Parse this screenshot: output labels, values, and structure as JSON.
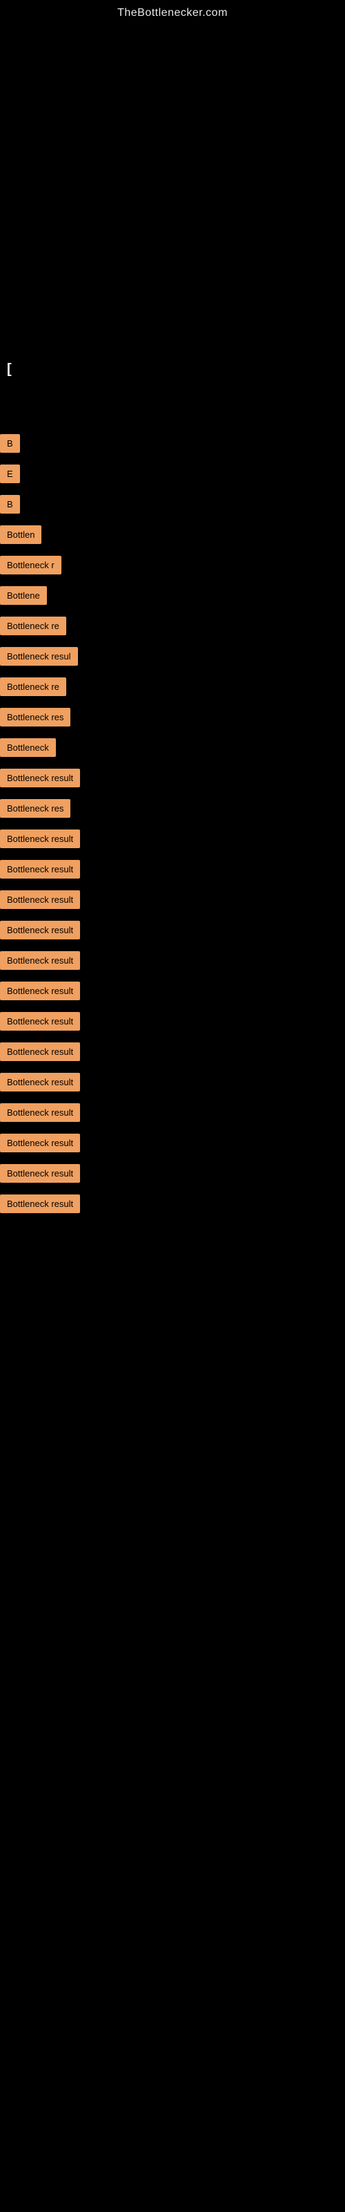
{
  "site": {
    "title": "TheBottlenecker.com"
  },
  "cursor": {
    "symbol": "["
  },
  "results": [
    {
      "id": 1,
      "label": "B",
      "width_class": "badge-w1"
    },
    {
      "id": 2,
      "label": "E",
      "width_class": "badge-w2"
    },
    {
      "id": 3,
      "label": "B",
      "width_class": "badge-w3"
    },
    {
      "id": 4,
      "label": "Bottlen",
      "width_class": "badge-w4"
    },
    {
      "id": 5,
      "label": "Bottleneck r",
      "width_class": "badge-w5"
    },
    {
      "id": 6,
      "label": "Bottlene",
      "width_class": "badge-w6"
    },
    {
      "id": 7,
      "label": "Bottleneck re",
      "width_class": "badge-w7"
    },
    {
      "id": 8,
      "label": "Bottleneck resul",
      "width_class": "badge-w8"
    },
    {
      "id": 9,
      "label": "Bottleneck re",
      "width_class": "badge-w9"
    },
    {
      "id": 10,
      "label": "Bottleneck res",
      "width_class": "badge-w10"
    },
    {
      "id": 11,
      "label": "Bottleneck",
      "width_class": "badge-w11"
    },
    {
      "id": 12,
      "label": "Bottleneck result",
      "width_class": "badge-w12"
    },
    {
      "id": 13,
      "label": "Bottleneck res",
      "width_class": "badge-w13"
    },
    {
      "id": 14,
      "label": "Bottleneck result",
      "width_class": "badge-w14"
    },
    {
      "id": 15,
      "label": "Bottleneck result",
      "width_class": "badge-w15"
    },
    {
      "id": 16,
      "label": "Bottleneck result",
      "width_class": "badge-w16"
    },
    {
      "id": 17,
      "label": "Bottleneck result",
      "width_class": "badge-w17"
    },
    {
      "id": 18,
      "label": "Bottleneck result",
      "width_class": "badge-w18"
    },
    {
      "id": 19,
      "label": "Bottleneck result",
      "width_class": "badge-w19"
    },
    {
      "id": 20,
      "label": "Bottleneck result",
      "width_class": "badge-w20"
    },
    {
      "id": 21,
      "label": "Bottleneck result",
      "width_class": "badge-w21"
    },
    {
      "id": 22,
      "label": "Bottleneck result",
      "width_class": "badge-w22"
    },
    {
      "id": 23,
      "label": "Bottleneck result",
      "width_class": "badge-w23"
    },
    {
      "id": 24,
      "label": "Bottleneck result",
      "width_class": "badge-w24"
    },
    {
      "id": 25,
      "label": "Bottleneck result",
      "width_class": "badge-w25"
    },
    {
      "id": 26,
      "label": "Bottleneck result",
      "width_class": "badge-w26"
    }
  ]
}
